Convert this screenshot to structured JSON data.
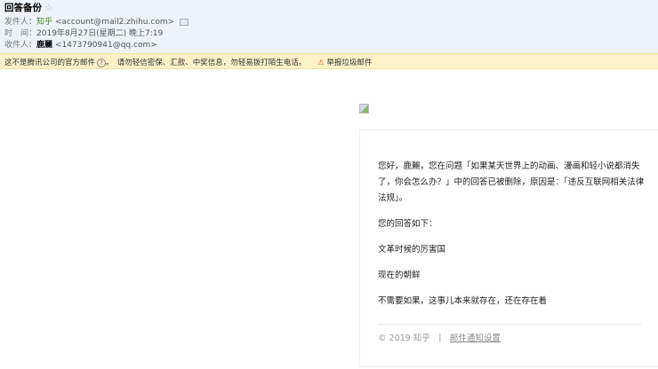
{
  "header": {
    "subject": "回答备份",
    "star": "☆",
    "from_label": "发件人：",
    "from_name": "知乎",
    "from_addr": "<account@mail2.zhihu.com>",
    "time_label": "时　间：",
    "time_value": "2019年8月27日(星期二) 晚上7:19",
    "to_label": "收件人：",
    "to_name": "鹿麗",
    "to_addr": "<1473790941@qq.com>"
  },
  "warning": {
    "text1": "这不是腾讯公司的官方邮件",
    "help": "?",
    "text2": "。　请勿轻信密保、汇款、中奖信息，勿轻易拨打陌生电话。",
    "report_icon": "report-icon",
    "report": "举报垃圾邮件"
  },
  "email": {
    "paragraphs": [
      "您好，鹿麗，您在问题「如果某天世界上的动画、漫画和轻小说都消失了，你会怎么办？」中的回答已被删除，原因是：「违反互联网相关法律法规」。",
      "您的回答如下：",
      "文革时候的厉害国",
      "现在的朝鲜",
      "不需要如果，这事儿本来就存在，还在存在着"
    ],
    "footer_copy": "© 2019 知乎　|　",
    "footer_link": "邮件通知设置"
  }
}
